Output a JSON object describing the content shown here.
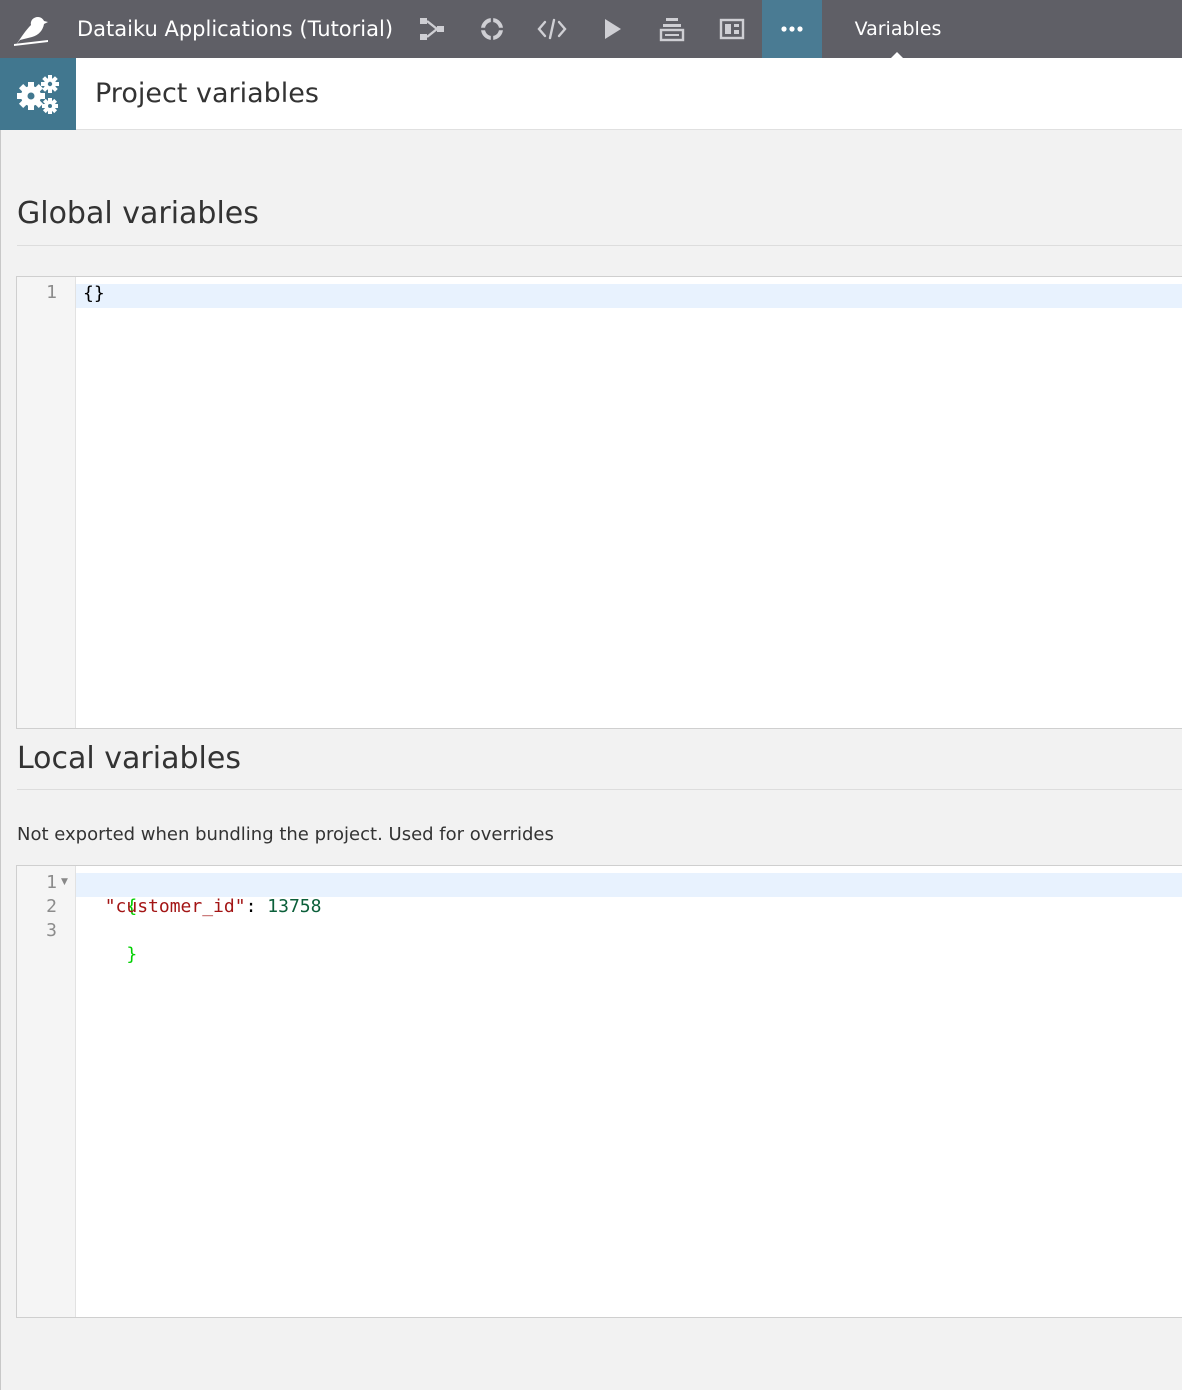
{
  "topbar": {
    "project_name": "Dataiku Applications (Tutorial)",
    "icons": [
      "flow-icon",
      "lab-icon",
      "code-icon",
      "run-icon",
      "jobs-icon",
      "dashboard-icon",
      "more-icon"
    ],
    "active_tab": "Variables"
  },
  "header": {
    "title": "Project variables",
    "icon": "gears-icon"
  },
  "global": {
    "title": "Global variables",
    "editor": {
      "lines": [
        {
          "number": "1",
          "text": "{}"
        }
      ]
    }
  },
  "local": {
    "title": "Local variables",
    "description": "Not exported when bundling the project. Used for overrides",
    "editor": {
      "lines": [
        {
          "number": "1",
          "open": "{"
        },
        {
          "number": "2",
          "key": "\"customer_id\"",
          "sep": ": ",
          "value": "13758"
        },
        {
          "number": "3",
          "close": "}"
        }
      ]
    }
  },
  "colors": {
    "topbar": "#5f5f66",
    "accent": "#41778f",
    "more_button": "#4a7b93",
    "active_line": "#e8f2fe"
  }
}
